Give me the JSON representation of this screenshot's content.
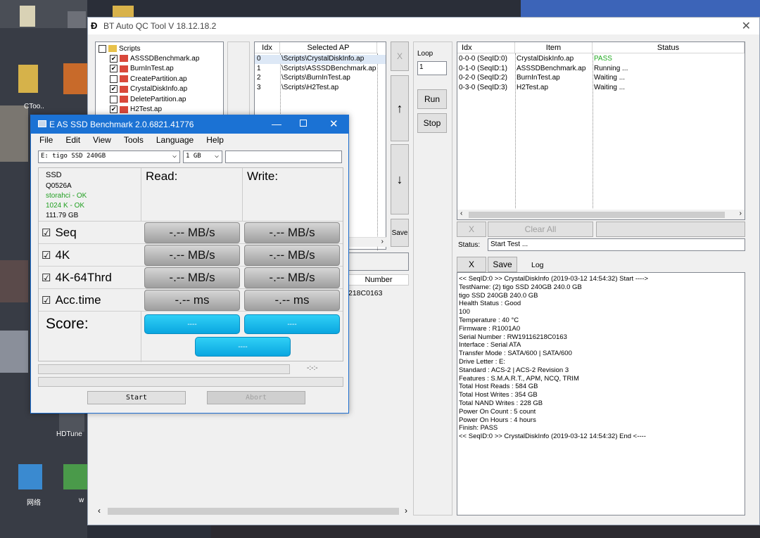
{
  "main_window": {
    "title": "BT Auto QC Tool V 18.12.18.2",
    "close_glyph": "✕"
  },
  "script_tree": {
    "root": "Scripts",
    "items": [
      {
        "label": "ASSSDBenchmark.ap",
        "checked": true
      },
      {
        "label": "BurnInTest.ap",
        "checked": true
      },
      {
        "label": "CreatePartition.ap",
        "checked": false
      },
      {
        "label": "CrystalDiskInfo.ap",
        "checked": true
      },
      {
        "label": "DeletePartition.ap",
        "checked": false
      },
      {
        "label": "H2Test.ap",
        "checked": true
      }
    ]
  },
  "selected_ap": {
    "headers": [
      "Idx",
      "Selected AP"
    ],
    "rows": [
      {
        "idx": "0",
        "path": "\\Scripts\\CrystalDiskInfo.ap"
      },
      {
        "idx": "1",
        "path": "\\Scripts\\ASSSDBenchmark.ap"
      },
      {
        "idx": "2",
        "path": "\\Scripts\\BurnInTest.ap"
      },
      {
        "idx": "3",
        "path": "\\Scripts\\H2Test.ap"
      }
    ],
    "remove_label": "X",
    "up_label": "↑",
    "down_label": "↓",
    "save_label": "Save",
    "lower_header": "Number",
    "lower_value": "218C0163"
  },
  "loop": {
    "label": "Loop",
    "value": "1",
    "run_label": "Run",
    "stop_label": "Stop"
  },
  "status_table": {
    "headers": [
      "Idx",
      "Item",
      "Status"
    ],
    "rows": [
      {
        "idx": "0-0-0 (SeqID:0)",
        "item": "CrystalDiskInfo.ap",
        "status": "PASS",
        "color": "#22aa22"
      },
      {
        "idx": "0-1-0 (SeqID:1)",
        "item": "ASSSDBenchmark.ap",
        "status": "Running ...",
        "color": "#000000"
      },
      {
        "idx": "0-2-0 (SeqID:2)",
        "item": "BurnInTest.ap",
        "status": "Waiting ...",
        "color": "#000000"
      },
      {
        "idx": "0-3-0 (SeqID:3)",
        "item": "H2Test.ap",
        "status": "Waiting ...",
        "color": "#000000"
      }
    ],
    "x_label": "X",
    "clear_all_label": "Clear All",
    "status_label": "Status:",
    "status_value": "Start Test ..."
  },
  "log_panel": {
    "x_label": "X",
    "save_label": "Save",
    "title": "Log",
    "lines": [
      "<< SeqID:0 >> CrystalDiskInfo (2019-03-12 14:54:32) Start ---->",
      "TestName: (2) tigo SSD 240GB 240.0 GB",
      "tigo SSD 240GB 240.0 GB",
      "Health Status : Good",
      "100",
      "Temperature : 40 °C",
      "Firmware : R1001A0",
      "Serial Number : RW19116218C0163",
      "Interface : Serial ATA",
      "Transfer Mode : SATA/600 | SATA/600",
      "Drive Letter : E:",
      "Standard : ACS-2 | ACS-2 Revision 3",
      "Features : S.M.A.R.T., APM, NCQ, TRIM",
      "Total Host Reads : 584 GB",
      "Total Host Writes : 354 GB",
      "Total NAND Writes : 228 GB",
      "Power On Count : 5 count",
      "Power On Hours : 4 hours",
      "Finish: PASS",
      "<< SeqID:0 >> CrystalDiskInfo (2019-03-12 14:54:32) End <----"
    ]
  },
  "as_ssd": {
    "title": "E AS SSD Benchmark 2.0.6821.41776",
    "menu": [
      "File",
      "Edit",
      "View",
      "Tools",
      "Language",
      "Help"
    ],
    "drive": "E: tigo SSD 240GB",
    "size": "1 GB",
    "info": {
      "model": "SSD",
      "firmware": "Q0526A",
      "driver": "storahci - OK",
      "align": "1024 K - OK",
      "capacity": "111.79 GB"
    },
    "read_header": "Read:",
    "write_header": "Write:",
    "rows": [
      {
        "label": "Seq",
        "read": "-.-- MB/s",
        "write": "-.-- MB/s"
      },
      {
        "label": "4K",
        "read": "-.-- MB/s",
        "write": "-.-- MB/s"
      },
      {
        "label": "4K-64Thrd",
        "read": "-.-- MB/s",
        "write": "-.-- MB/s"
      },
      {
        "label": "Acc.time",
        "read": "-.-- ms",
        "write": "-.-- ms"
      }
    ],
    "check_glyph": "☑",
    "score_label": "Score:",
    "score_read": "----",
    "score_write": "----",
    "score_total": "----",
    "timer": "-:-:-",
    "start_label": "Start",
    "abort_label": "Abort",
    "colors": {
      "titlebar": "#1b72d4",
      "info_green": "#22a022",
      "score": "#18b8ec"
    }
  },
  "desktop": {
    "icon_labels": [
      "CToo..",
      "HDTune",
      "网络",
      "w"
    ]
  }
}
